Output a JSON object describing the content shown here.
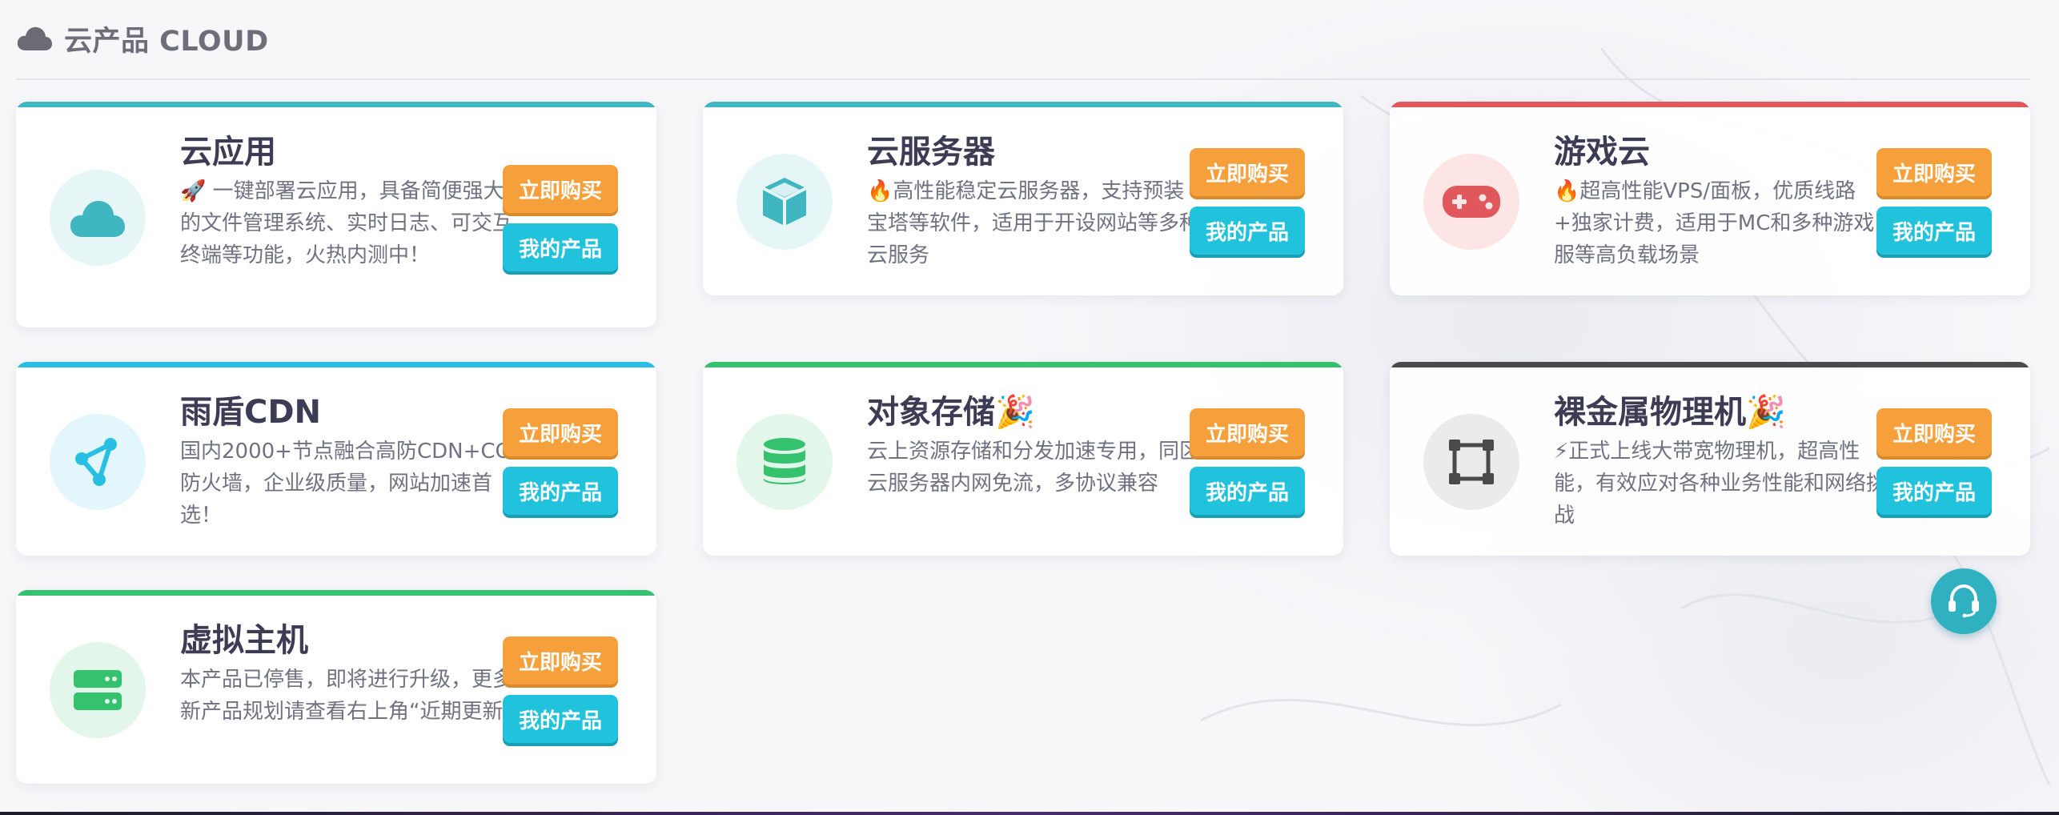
{
  "section": {
    "title": "云产品 CLOUD",
    "icon": "cloud-icon"
  },
  "buttons": {
    "buy_label": "立即购买",
    "mine_label": "我的产品"
  },
  "colors": {
    "buy": "#f6a03c",
    "mine": "#21c2dc",
    "teal": "#3fb6c0",
    "red": "#e0575c",
    "sky": "#27c0e4",
    "green": "#35c26f",
    "dark": "#4a4a4a"
  },
  "products": [
    {
      "title": "云应用",
      "description": "🚀 一键部署云应用，具备简便强大的文件管理系统、实时日志、可交互终端等功能，火热内测中！",
      "icon": "cloud-icon",
      "accent": "#3fb6c0"
    },
    {
      "title": "云服务器",
      "description": "🔥高性能稳定云服务器，支持预装宝塔等软件，适用于开设网站等多种云服务",
      "icon": "cube-icon",
      "accent": "#3fb6c0"
    },
    {
      "title": "游戏云",
      "description": "🔥超高性能VPS/面板，优质线路+独家计费，适用于MC和多种游戏服等高负载场景",
      "icon": "gamepad-icon",
      "accent": "#e0575c"
    },
    {
      "title": "雨盾CDN",
      "description": "国内2000+节点融合高防CDN+CC防火墙，企业级质量，网站加速首选！",
      "icon": "network-nodes-icon",
      "accent": "#27c0e4"
    },
    {
      "title": "对象存储🎉",
      "description": "云上资源存储和分发加速专用，同区云服务器内网免流，多协议兼容",
      "icon": "database-icon",
      "accent": "#35c26f"
    },
    {
      "title": "裸金属物理机🎉",
      "description": "⚡正式上线大带宽物理机，超高性能，有效应对各种业务性能和网络挑战",
      "icon": "vector-square-icon",
      "accent": "#4a4a4a"
    },
    {
      "title": "虚拟主机",
      "description": "本产品已停售，即将进行升级，更多新产品规划请查看右上角“近期更新”",
      "icon": "server-icon",
      "accent": "#35c26f"
    }
  ],
  "support": {
    "icon": "headset-icon"
  }
}
